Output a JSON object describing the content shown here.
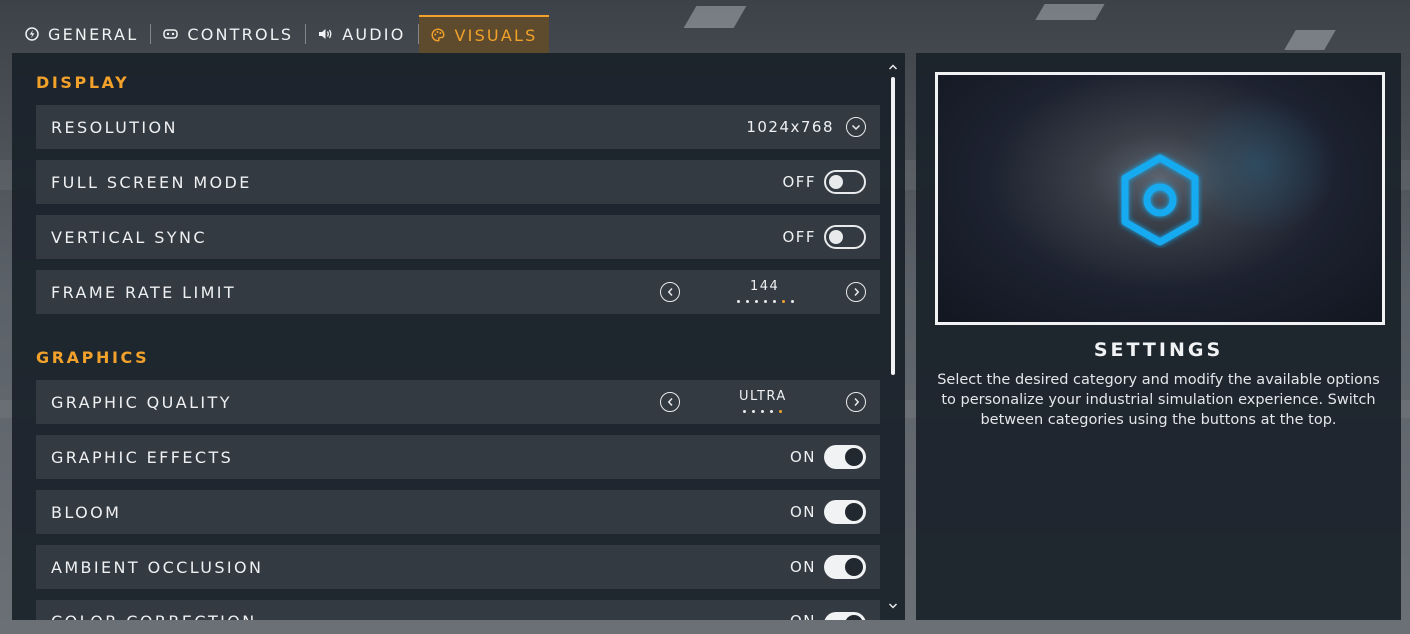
{
  "tabs": [
    {
      "label": "GENERAL",
      "icon": "power-bolt-icon",
      "active": false
    },
    {
      "label": "CONTROLS",
      "icon": "gamepad-icon",
      "active": false
    },
    {
      "label": "AUDIO",
      "icon": "speaker-icon",
      "active": false
    },
    {
      "label": "VISUALS",
      "icon": "palette-icon",
      "active": true
    }
  ],
  "colors": {
    "accent": "#f2a22a",
    "panel": "#1a212a",
    "row": "#343a42",
    "preview_icon": "#18aaf0"
  },
  "display": {
    "title": "DISPLAY",
    "resolution": {
      "label": "RESOLUTION",
      "value": "1024x768"
    },
    "fullscreen": {
      "label": "FULL SCREEN MODE",
      "state": "OFF"
    },
    "vsync": {
      "label": "VERTICAL SYNC",
      "state": "OFF"
    },
    "framerate": {
      "label": "FRAME RATE LIMIT",
      "value": "144",
      "steps": 7,
      "selected_step": 6
    }
  },
  "graphics": {
    "title": "GRAPHICS",
    "quality": {
      "label": "GRAPHIC QUALITY",
      "value": "ULTRA",
      "steps": 5,
      "selected_step": 5
    },
    "effects": {
      "label": "GRAPHIC EFFECTS",
      "state": "ON"
    },
    "bloom": {
      "label": "BLOOM",
      "state": "ON"
    },
    "ao": {
      "label": "AMBIENT OCCLUSION",
      "state": "ON"
    },
    "color_correction": {
      "label": "COLOR CORRECTION",
      "state": "ON"
    }
  },
  "info": {
    "title": "SETTINGS",
    "description": "Select the desired category and modify the available options to personalize your industrial simulation experience. Switch between categories using the buttons at the top."
  }
}
